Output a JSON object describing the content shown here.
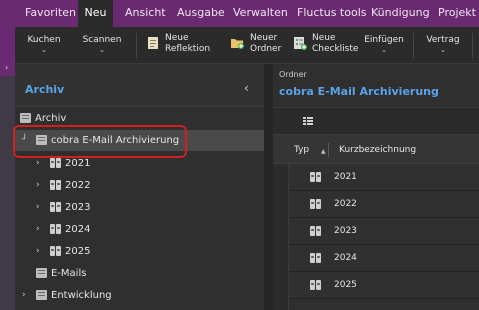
{
  "ribbon": {
    "tabs": [
      {
        "label": "Favoriten",
        "active": false
      },
      {
        "label": "Neu",
        "active": true
      },
      {
        "label": "Ansicht",
        "active": false
      },
      {
        "label": "Ausgabe",
        "active": false
      },
      {
        "label": "Verwalten",
        "active": false
      },
      {
        "label": "Fluctus tools",
        "active": false
      },
      {
        "label": "Kündigung",
        "active": false
      },
      {
        "label": "Projekt",
        "active": false
      }
    ],
    "toolbar": {
      "kuchen": "Kuchen",
      "scannen": "Scannen",
      "neue_reflektion": [
        "Neue",
        "Reflektion"
      ],
      "neuer_ordner": [
        "Neuer",
        "Ordner"
      ],
      "neue_checkliste": [
        "Neue",
        "Checkliste"
      ],
      "einfuegen": "Einfügen",
      "vertrag": "Vertrag"
    }
  },
  "left_panel": {
    "title": "Archiv",
    "tree": [
      {
        "label": "Archiv",
        "level": 0,
        "expander": "",
        "icon": "cabinet-icon"
      },
      {
        "label": "cobra E-Mail Archivierung",
        "level": 1,
        "expander": "┘",
        "icon": "cabinet-icon",
        "selected": true
      },
      {
        "label": "2021",
        "level": 2,
        "expander": "›",
        "icon": "binder-icon"
      },
      {
        "label": "2022",
        "level": 2,
        "expander": "›",
        "icon": "binder-icon"
      },
      {
        "label": "2023",
        "level": 2,
        "expander": "›",
        "icon": "binder-icon"
      },
      {
        "label": "2024",
        "level": 2,
        "expander": "›",
        "icon": "binder-icon"
      },
      {
        "label": "2025",
        "level": 2,
        "expander": "›",
        "icon": "binder-icon"
      },
      {
        "label": "E-Mails",
        "level": 1,
        "expander": "",
        "icon": "cabinet-icon"
      },
      {
        "label": "Entwicklung",
        "level": 0,
        "expander": "›",
        "icon": "cabinet-icon"
      }
    ]
  },
  "right_panel": {
    "caption": "Ordner",
    "title": "cobra E-Mail Archivierung",
    "columns": {
      "typ": "Typ",
      "name": "Kurzbezeichnung"
    },
    "rows": [
      "2021",
      "2022",
      "2023",
      "2024",
      "2025"
    ]
  },
  "colors": {
    "accent_blue": "#5aa3e8",
    "ribbon_purple": "#6a2a72",
    "highlight_red": "#d02020"
  }
}
